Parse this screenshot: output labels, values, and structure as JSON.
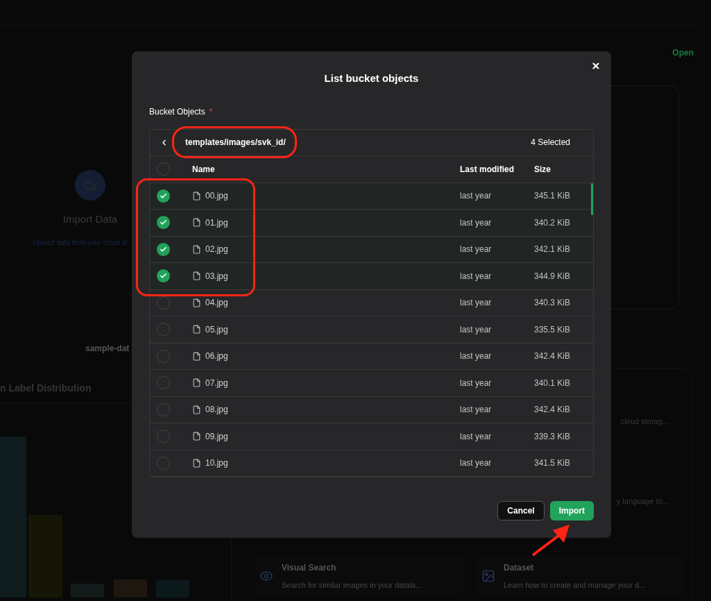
{
  "background": {
    "import_card": {
      "title": "Import Data",
      "subtitle": "Upload data from your cloud st"
    },
    "dataset_tag": "sample-dat",
    "chart_title": "n Label Distribution",
    "top_right_link": "Open",
    "cut_descriptions": [
      "cloud storag...",
      "y language to..."
    ],
    "feature_cards": [
      {
        "kind": "eye",
        "title": "Visual Search",
        "description": "Search for similar images in your datala..."
      },
      {
        "kind": "image",
        "title": "Dataset",
        "description": "Learn how to create and manage your d..."
      }
    ]
  },
  "dialog": {
    "title": "List bucket objects",
    "field_label": "Bucket Objects",
    "required": true,
    "required_mark": "*",
    "path": "templates/images/svk_id/",
    "selected_count": "4 Selected",
    "select_all": false,
    "columns": [
      "Name",
      "Last modified",
      "Size"
    ],
    "rows": [
      {
        "name": "00.jpg",
        "modified": "last year",
        "size": "345.1 KiB",
        "selected": true
      },
      {
        "name": "01.jpg",
        "modified": "last year",
        "size": "340.2 KiB",
        "selected": true
      },
      {
        "name": "02.jpg",
        "modified": "last year",
        "size": "342.1 KiB",
        "selected": true
      },
      {
        "name": "03.jpg",
        "modified": "last year",
        "size": "344.9 KiB",
        "selected": true
      },
      {
        "name": "04.jpg",
        "modified": "last year",
        "size": "340.3 KiB",
        "selected": false
      },
      {
        "name": "05.jpg",
        "modified": "last year",
        "size": "335.5 KiB",
        "selected": false
      },
      {
        "name": "06.jpg",
        "modified": "last year",
        "size": "342.4 KiB",
        "selected": false
      },
      {
        "name": "07.jpg",
        "modified": "last year",
        "size": "340.1 KiB",
        "selected": false
      },
      {
        "name": "08.jpg",
        "modified": "last year",
        "size": "342.4 KiB",
        "selected": false
      },
      {
        "name": "09.jpg",
        "modified": "last year",
        "size": "339.3 KiB",
        "selected": false
      },
      {
        "name": "10.jpg",
        "modified": "last year",
        "size": "341.5 KiB",
        "selected": false
      }
    ],
    "buttons": [
      {
        "kind": "secondary",
        "label": "Cancel"
      },
      {
        "kind": "primary",
        "label": "Import"
      }
    ]
  }
}
